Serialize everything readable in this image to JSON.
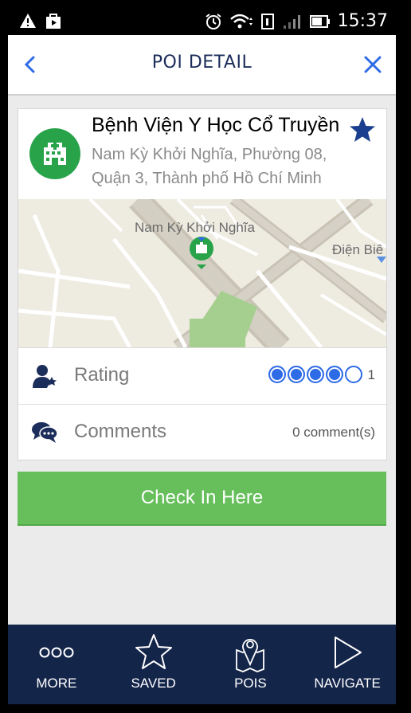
{
  "status_bar": {
    "time": "15:37"
  },
  "header": {
    "title": "POI DETAIL"
  },
  "poi": {
    "name": "Bệnh Viện Y Học Cổ Truyền",
    "address_line1": "Nam Kỳ Khởi Nghĩa, Phường 08,",
    "address_line2": "Quận 3, Thành phố Hồ Chí Minh",
    "icon": "hospital-icon"
  },
  "map": {
    "labels": [
      "Nam Kỳ Khởi Nghĩa",
      "Điện Biê"
    ]
  },
  "rating": {
    "label": "Rating",
    "value": 4,
    "max": 5,
    "count": "1"
  },
  "comments": {
    "label": "Comments",
    "count_text": "0 comment(s)"
  },
  "checkin": {
    "label": "Check In Here"
  },
  "bottom_nav": [
    {
      "label": "MORE",
      "icon": "more-dots-icon"
    },
    {
      "label": "SAVED",
      "icon": "star-outline-icon"
    },
    {
      "label": "POIS",
      "icon": "map-pin-icon"
    },
    {
      "label": "NAVIGATE",
      "icon": "play-triangle-icon"
    }
  ],
  "colors": {
    "primary_navy": "#14254a",
    "accent_blue": "#2e6be6",
    "check_in_green": "#66bf5b",
    "poi_icon_green": "#28a34a"
  }
}
